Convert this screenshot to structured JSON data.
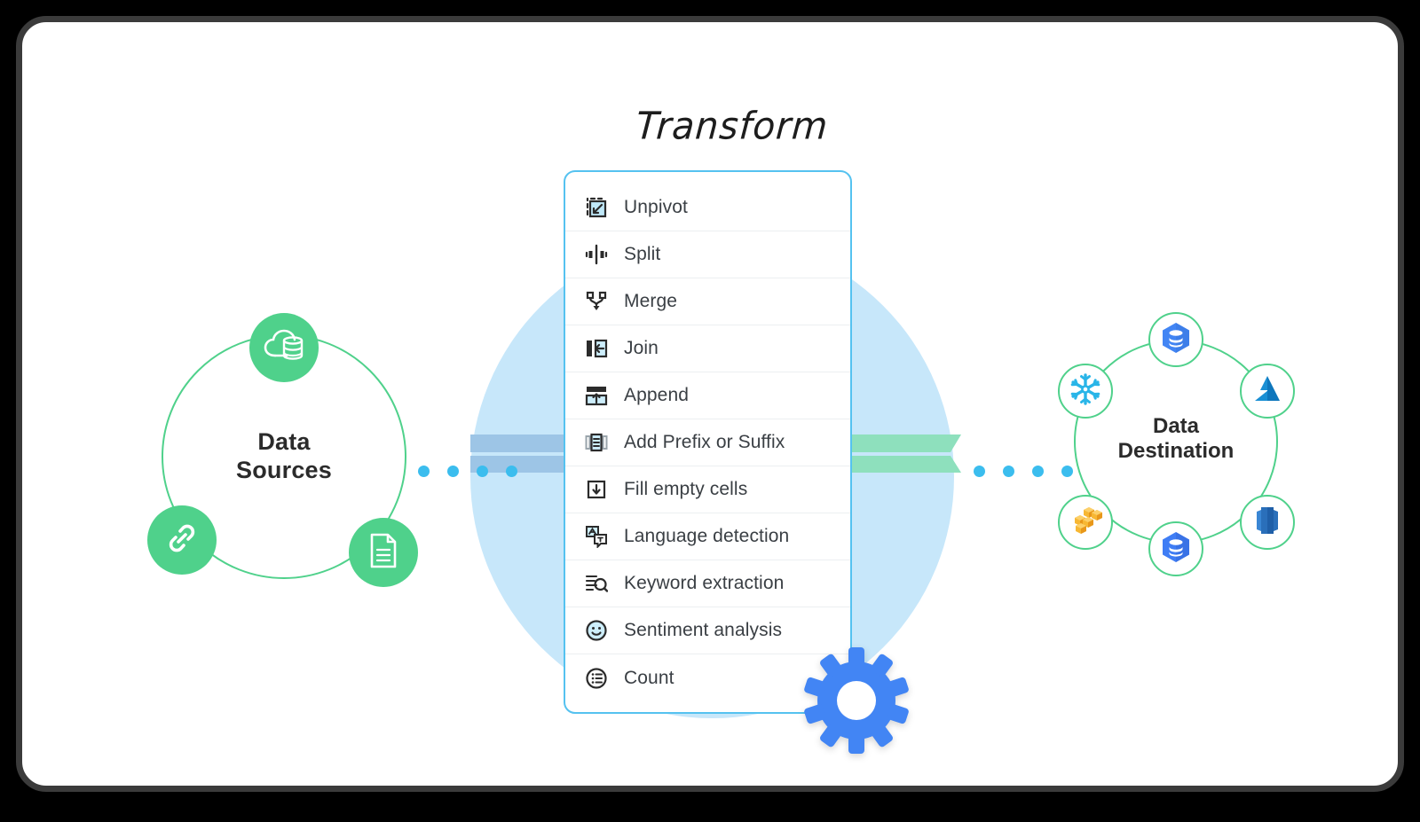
{
  "title": "Transform",
  "sources": {
    "label_line1": "Data",
    "label_line2": "Sources",
    "ring_color": "#4fd18b",
    "node_color": "#4fd18b",
    "nodes": [
      {
        "name": "cloud-database-icon",
        "position": "top"
      },
      {
        "name": "link-icon",
        "position": "bottom-left"
      },
      {
        "name": "document-icon",
        "position": "bottom-right"
      }
    ]
  },
  "destination": {
    "label_line1": "Data",
    "label_line2": "Destination",
    "ring_color": "#4fd18b",
    "nodes": [
      {
        "name": "bigquery-icon",
        "position": "top",
        "color": "#4285f4"
      },
      {
        "name": "azure-icon",
        "position": "right",
        "color": "#0e76bc"
      },
      {
        "name": "redshift-icon",
        "position": "bottom-right",
        "color": "#2a6fba"
      },
      {
        "name": "bigquery-icon",
        "position": "bottom",
        "color": "#2f7dea"
      },
      {
        "name": "aws-cubes-icon",
        "position": "bottom-left",
        "color": "#f5a623"
      },
      {
        "name": "snowflake-icon",
        "position": "left",
        "color": "#29b5e8"
      }
    ]
  },
  "menu": {
    "border_color": "#55c2f0",
    "items": [
      {
        "label": "Unpivot",
        "icon": "unpivot-icon"
      },
      {
        "label": "Split",
        "icon": "split-icon"
      },
      {
        "label": "Merge",
        "icon": "merge-icon"
      },
      {
        "label": "Join",
        "icon": "join-icon"
      },
      {
        "label": "Append",
        "icon": "append-icon"
      },
      {
        "label": "Add Prefix or Suffix",
        "icon": "prefix-suffix-icon"
      },
      {
        "label": "Fill empty cells",
        "icon": "fill-empty-cells-icon"
      },
      {
        "label": "Language detection",
        "icon": "language-detection-icon"
      },
      {
        "label": "Keyword extraction",
        "icon": "keyword-extraction-icon"
      },
      {
        "label": "Sentiment analysis",
        "icon": "sentiment-analysis-icon"
      },
      {
        "label": "Count",
        "icon": "count-icon"
      }
    ]
  },
  "connectors": {
    "left_dot_count": 4,
    "right_dot_count": 4,
    "dot_color": "#3bbdee",
    "left_band_color": "#9dc5e6",
    "right_band_color": "#8ee0bd"
  },
  "decor": {
    "center_disc_color": "#c7e7fa",
    "gear_icon": "gear-icon",
    "gear_color": "#4285f4",
    "frame_color": "#3b3b3b"
  }
}
